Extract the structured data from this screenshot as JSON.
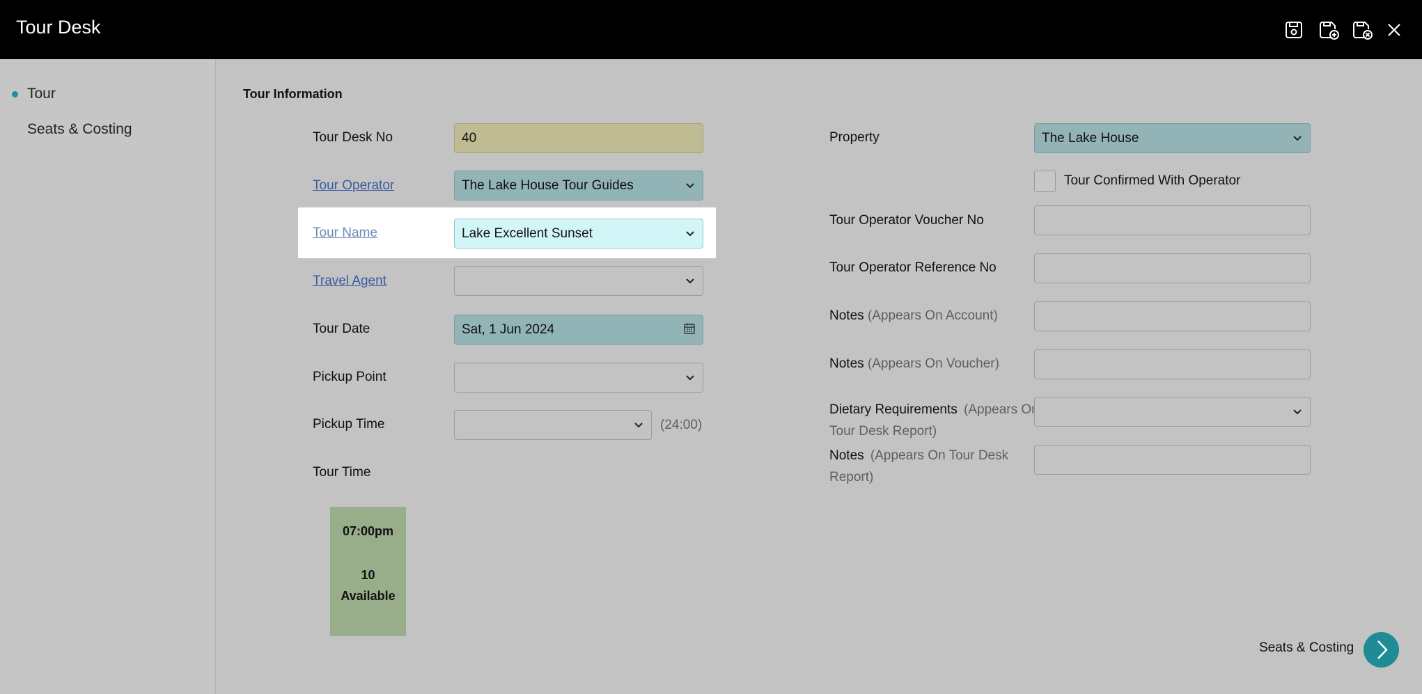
{
  "app": {
    "title": "Tour Desk"
  },
  "toolbar": {
    "icons": [
      "save-icon",
      "save-and-new-icon",
      "save-and-close-icon",
      "close-icon"
    ]
  },
  "sidebar": {
    "items": [
      {
        "label": "Tour",
        "active": true
      },
      {
        "label": "Seats & Costing",
        "active": false
      }
    ]
  },
  "section": {
    "title": "Tour Information"
  },
  "form_left": {
    "tour_desk_no": {
      "label": "Tour Desk No",
      "value": "40"
    },
    "tour_operator": {
      "label": "Tour Operator",
      "value": "The Lake House Tour Guides"
    },
    "tour_name": {
      "label": "Tour Name",
      "value": "Lake Excellent Sunset"
    },
    "travel_agent": {
      "label": "Travel Agent",
      "value": ""
    },
    "tour_date": {
      "label": "Tour Date",
      "value": "Sat, 1 Jun 2024"
    },
    "pickup_point": {
      "label": "Pickup Point",
      "value": ""
    },
    "pickup_time": {
      "label": "Pickup Time",
      "value": "",
      "hint": "(24:00)"
    },
    "tour_time": {
      "label": "Tour Time"
    }
  },
  "tour_slot": {
    "time": "07:00pm",
    "count": "10",
    "status": "Available"
  },
  "form_right": {
    "property": {
      "label": "Property",
      "value": "The Lake House"
    },
    "confirmed": {
      "label": "Tour Confirmed With Operator",
      "checked": false
    },
    "voucher_no": {
      "label": "Tour Operator Voucher No",
      "value": ""
    },
    "reference_no": {
      "label": "Tour Operator Reference No",
      "value": ""
    },
    "notes_account": {
      "label": "Notes",
      "hint": "(Appears On Account)",
      "value": ""
    },
    "notes_voucher": {
      "label": "Notes",
      "hint": "(Appears On Voucher)",
      "value": ""
    },
    "dietary": {
      "label": "Dietary Requirements",
      "hint1": "(Appears On",
      "hint2": "Tour Desk Report)",
      "value": ""
    },
    "notes_report": {
      "label": "Notes",
      "hint1": "(Appears On Tour Desk",
      "hint2": "Report)",
      "value": ""
    }
  },
  "footer": {
    "next_label": "Seats & Costing"
  },
  "colors": {
    "accent": "#1f8b95",
    "yellow_field": "#bfbb92",
    "teal_field": "#92b4b6",
    "slot_green": "#98ad8a"
  }
}
